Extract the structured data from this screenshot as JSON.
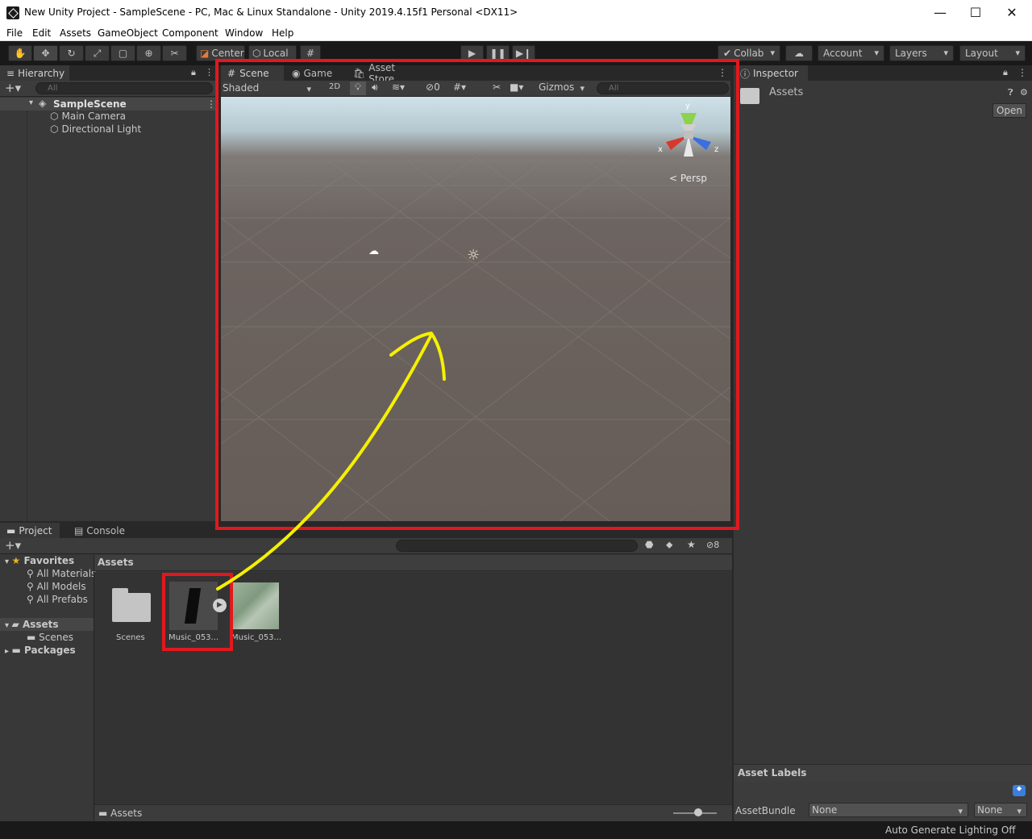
{
  "window": {
    "title": "New Unity Project - SampleScene - PC, Mac & Linux Standalone - Unity 2019.4.15f1 Personal <DX11>",
    "minimize": "—",
    "maximize": "☐",
    "close": "✕"
  },
  "menu": [
    "File",
    "Edit",
    "Assets",
    "GameObject",
    "Component",
    "Window",
    "Help"
  ],
  "toolbar": {
    "pivot": "Center",
    "space": "Local",
    "collab": "Collab",
    "account": "Account",
    "layers": "Layers",
    "layout": "Layout"
  },
  "hierarchy": {
    "tab": "Hierarchy",
    "search_placeholder": "All",
    "scene": "SampleScene",
    "objects": [
      "Main Camera",
      "Directional Light"
    ]
  },
  "scene_panel": {
    "tabs": [
      "Scene",
      "Game",
      "Asset Store"
    ],
    "shading": "Shaded",
    "mode_2d": "2D",
    "hidden_count": "0",
    "gizmos": "Gizmos",
    "search_placeholder": "All",
    "projection": "Persp",
    "axis_x": "x",
    "axis_y": "y",
    "axis_z": "z"
  },
  "inspector": {
    "tab": "Inspector",
    "asset_name": "Assets",
    "open_button": "Open",
    "asset_labels": "Asset Labels",
    "asset_bundle_label": "AssetBundle",
    "bundle_value": "None",
    "variant_value": "None"
  },
  "project": {
    "tabs": [
      "Project",
      "Console"
    ],
    "hidden_count": "8",
    "favorites_label": "Favorites",
    "favorites": [
      "All Materials",
      "All Models",
      "All Prefabs"
    ],
    "assets_label": "Assets",
    "asset_children": [
      "Scenes"
    ],
    "packages_label": "Packages",
    "breadcrumb": "Assets",
    "path": "Assets",
    "grid_items": [
      "Scenes",
      "Music_053...",
      "Music_053..."
    ]
  },
  "status": {
    "lighting": "Auto Generate Lighting Off"
  },
  "colors": {
    "highlight": "#e0191e",
    "arrow": "#f5f000"
  }
}
